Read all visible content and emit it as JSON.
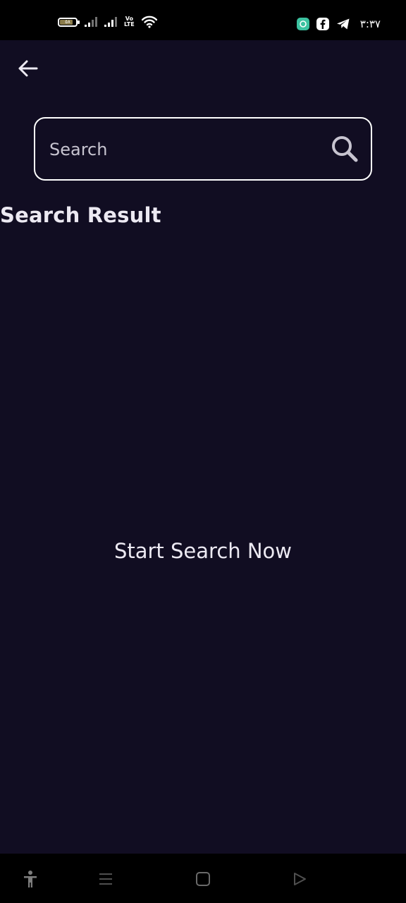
{
  "status_bar": {
    "battery_label": "٥٨",
    "network_label_top": "Vo",
    "network_label_bottom": "LTE",
    "time": "٣:٣٧",
    "icons": [
      "battery-icon",
      "signal-icon",
      "signal-icon",
      "volte-icon",
      "wifi-icon",
      "chat-app-icon",
      "facebook-icon",
      "telegram-icon"
    ]
  },
  "header": {
    "back_icon": "arrow-left-icon"
  },
  "search": {
    "placeholder": "Search",
    "value": "",
    "icon": "search-icon"
  },
  "results": {
    "title": "Search Result",
    "empty_message": "Start Search Now"
  },
  "navigation": {
    "icons": [
      "accessibility-icon",
      "menu-icon",
      "home-icon",
      "back-icon"
    ]
  },
  "colors": {
    "background": "#110d22",
    "text": "#ece9f2",
    "border": "#ffffff",
    "bars": "#000000"
  }
}
